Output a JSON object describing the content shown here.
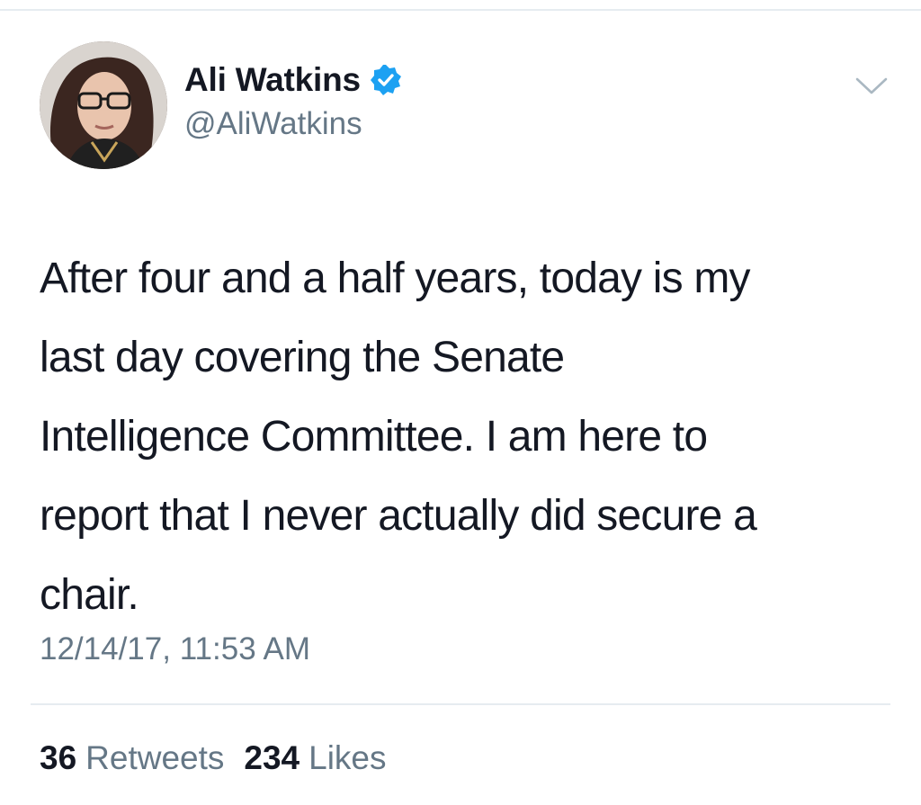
{
  "user": {
    "display_name": "Ali Watkins",
    "handle": "@AliWatkins",
    "verified": true,
    "avatar_icon": "profile-photo"
  },
  "tweet": {
    "text_lines": [
      "After four and a half years, today is my",
      "last day covering the Senate",
      "Intelligence Committee. I am here to",
      "report that I never actually did secure a",
      "chair."
    ],
    "timestamp": "12/14/17, 11:53 AM"
  },
  "stats": {
    "retweets_count": "36",
    "retweets_label": "Retweets",
    "likes_count": "234",
    "likes_label": "Likes"
  },
  "colors": {
    "verified_blue": "#1da1f2",
    "secondary_text": "#657786",
    "primary_text": "#141823",
    "divider": "#e6ecf0"
  },
  "icons": {
    "verified": "verified-badge-icon",
    "menu": "chevron-down-icon"
  }
}
